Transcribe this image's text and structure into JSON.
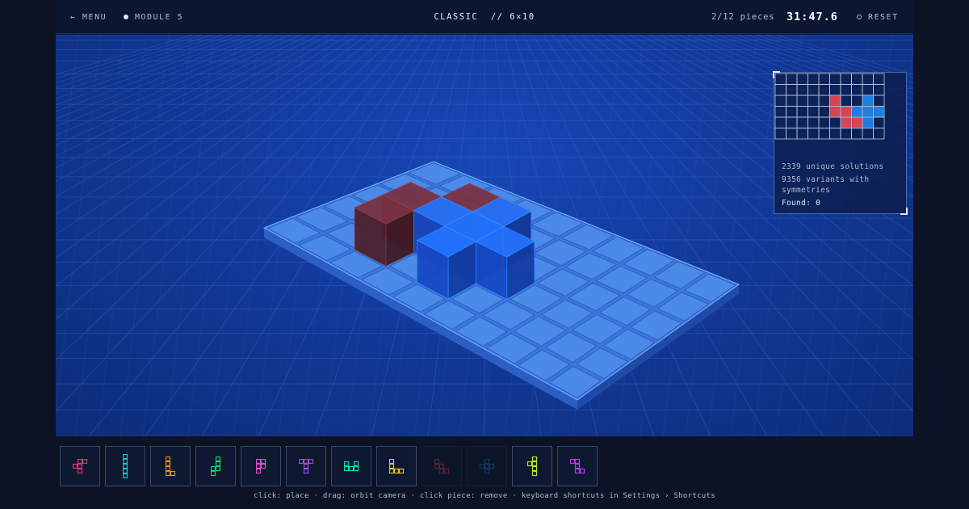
{
  "topbar": {
    "menu_label": "← MENU",
    "module_label": "MODULE 5",
    "mode_title": "CLASSIC  // 6×10",
    "pieces_count": "2/12 pieces",
    "timer": "31:47.6",
    "reset_label": "RESET"
  },
  "panel": {
    "unique_solutions": "2339 unique solutions",
    "variants": "9356 variants with symmetries",
    "found": "Found: 0",
    "board": {
      "cols": 10,
      "rows": 6,
      "cells": [
        {
          "r": 2,
          "c": 5,
          "color": "#d94452"
        },
        {
          "r": 3,
          "c": 5,
          "color": "#d94452"
        },
        {
          "r": 3,
          "c": 6,
          "color": "#d94452"
        },
        {
          "r": 4,
          "c": 6,
          "color": "#d94452"
        },
        {
          "r": 4,
          "c": 7,
          "color": "#d94452"
        },
        {
          "r": 2,
          "c": 8,
          "color": "#1a7fe0"
        },
        {
          "r": 3,
          "c": 7,
          "color": "#1a7fe0"
        },
        {
          "r": 3,
          "c": 8,
          "color": "#1a7fe0"
        },
        {
          "r": 3,
          "c": 9,
          "color": "#1a7fe0"
        },
        {
          "r": 4,
          "c": 8,
          "color": "#1a7fe0"
        }
      ]
    }
  },
  "scene": {
    "board_cols": 10,
    "board_rows": 6,
    "placed": [
      {
        "piece": "W",
        "color": "#5a2430",
        "cells": [
          [
            2,
            1
          ],
          [
            2,
            2
          ],
          [
            3,
            2
          ],
          [
            3,
            3
          ],
          [
            4,
            3
          ]
        ]
      },
      {
        "piece": "X",
        "color": "#1a55e8",
        "cells": [
          [
            4,
            1
          ],
          [
            3,
            2
          ],
          [
            4,
            2
          ],
          [
            5,
            2
          ],
          [
            4,
            3
          ]
        ]
      }
    ]
  },
  "tray": {
    "pieces": [
      {
        "name": "F",
        "color": "#e0336b",
        "used": false,
        "cells": [
          [
            1,
            0
          ],
          [
            2,
            0
          ],
          [
            0,
            1
          ],
          [
            1,
            1
          ],
          [
            1,
            2
          ]
        ]
      },
      {
        "name": "I",
        "color": "#16c2c9",
        "used": false,
        "cells": [
          [
            0,
            0
          ],
          [
            0,
            1
          ],
          [
            0,
            2
          ],
          [
            0,
            3
          ],
          [
            0,
            4
          ]
        ]
      },
      {
        "name": "L",
        "color": "#f08a1c",
        "used": false,
        "cells": [
          [
            0,
            0
          ],
          [
            0,
            1
          ],
          [
            0,
            2
          ],
          [
            0,
            3
          ],
          [
            1,
            3
          ]
        ]
      },
      {
        "name": "N",
        "color": "#22cf5a",
        "used": false,
        "cells": [
          [
            1,
            0
          ],
          [
            1,
            1
          ],
          [
            0,
            2
          ],
          [
            1,
            2
          ],
          [
            0,
            3
          ]
        ]
      },
      {
        "name": "P",
        "color": "#e04cc7",
        "used": false,
        "cells": [
          [
            0,
            0
          ],
          [
            1,
            0
          ],
          [
            0,
            1
          ],
          [
            1,
            1
          ],
          [
            0,
            2
          ]
        ]
      },
      {
        "name": "T",
        "color": "#9b4ce6",
        "used": false,
        "cells": [
          [
            0,
            0
          ],
          [
            1,
            0
          ],
          [
            2,
            0
          ],
          [
            1,
            1
          ],
          [
            1,
            2
          ]
        ]
      },
      {
        "name": "U",
        "color": "#1fd6a8",
        "used": false,
        "cells": [
          [
            0,
            0
          ],
          [
            2,
            0
          ],
          [
            0,
            1
          ],
          [
            1,
            1
          ],
          [
            2,
            1
          ]
        ]
      },
      {
        "name": "V",
        "color": "#e3c21a",
        "used": false,
        "cells": [
          [
            0,
            0
          ],
          [
            0,
            1
          ],
          [
            0,
            2
          ],
          [
            1,
            2
          ],
          [
            2,
            2
          ]
        ]
      },
      {
        "name": "W",
        "color": "#d94452",
        "used": true,
        "cells": [
          [
            0,
            0
          ],
          [
            0,
            1
          ],
          [
            1,
            1
          ],
          [
            1,
            2
          ],
          [
            2,
            2
          ]
        ]
      },
      {
        "name": "X",
        "color": "#1a7fe0",
        "used": true,
        "cells": [
          [
            1,
            0
          ],
          [
            0,
            1
          ],
          [
            1,
            1
          ],
          [
            2,
            1
          ],
          [
            1,
            2
          ]
        ]
      },
      {
        "name": "Y",
        "color": "#b7e62a",
        "used": false,
        "cells": [
          [
            1,
            0
          ],
          [
            0,
            1
          ],
          [
            1,
            1
          ],
          [
            1,
            2
          ],
          [
            1,
            3
          ]
        ]
      },
      {
        "name": "Z",
        "color": "#b23ce0",
        "used": false,
        "cells": [
          [
            0,
            0
          ],
          [
            1,
            0
          ],
          [
            1,
            1
          ],
          [
            1,
            2
          ],
          [
            2,
            2
          ]
        ]
      }
    ],
    "hint": "click: place · drag: orbit camera · click piece: remove · keyboard shortcuts in Settings › Shortcuts"
  },
  "icons": {
    "settings": "gear-icon"
  }
}
